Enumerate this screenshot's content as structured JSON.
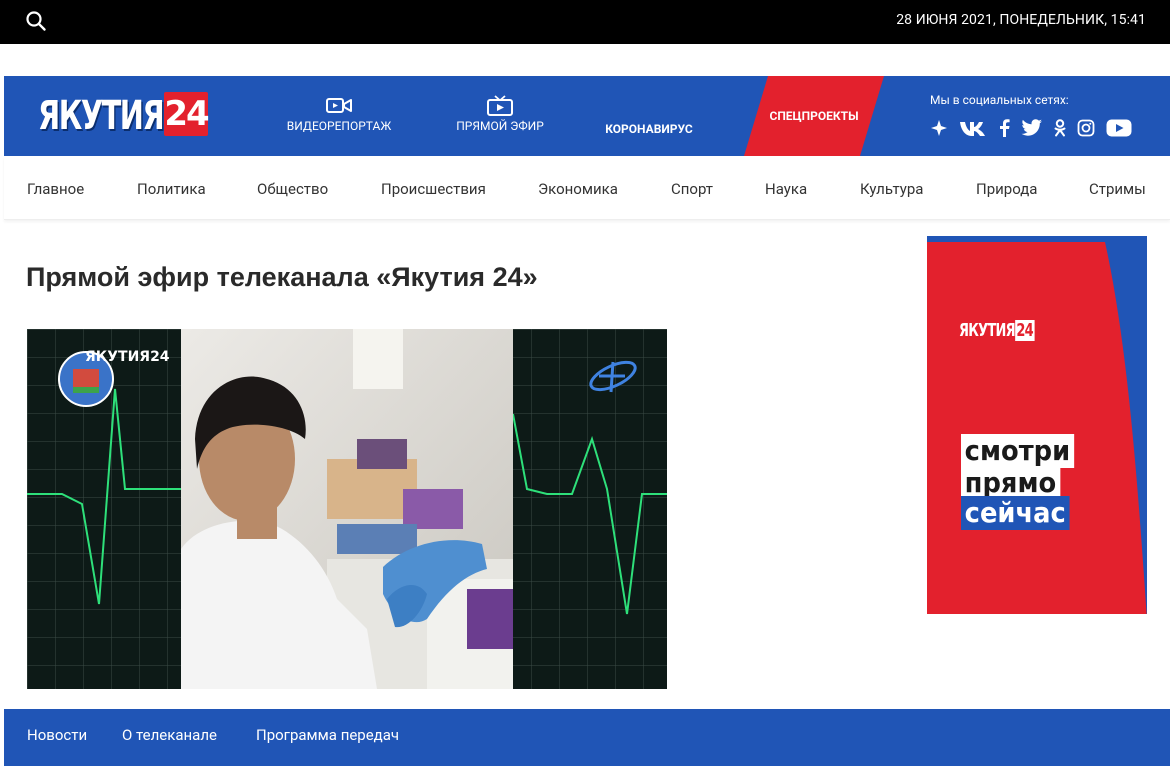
{
  "topbar": {
    "search_icon": "search-icon",
    "datetime": "28 ИЮНЯ 2021, ПОНЕДЕЛЬНИК, 15:41"
  },
  "header": {
    "logo_text": "ЯКУТИЯ",
    "logo_number": "24",
    "nav": [
      {
        "label": "ВИДЕОРЕПОРТАЖ",
        "icon": "video-camera-icon"
      },
      {
        "label": "ПРЯМОЙ ЭФИР",
        "icon": "tv-play-icon"
      },
      {
        "label": "КОРОНАВИРУС"
      }
    ],
    "special_label": "СПЕЦПРОЕКТЫ",
    "social_title": "Мы в социальных сетях:",
    "social_icons": [
      "yandex-zen-icon",
      "vk-icon",
      "facebook-icon",
      "twitter-icon",
      "odnoklassniki-icon",
      "instagram-icon",
      "youtube-icon"
    ],
    "colors": {
      "blue": "#2055b6",
      "red": "#e3212d"
    }
  },
  "categories": [
    "Главное",
    "Политика",
    "Общество",
    "Происшествия",
    "Экономика",
    "Спорт",
    "Наука",
    "Культура",
    "Природа",
    "Стримы"
  ],
  "main": {
    "title": "Прямой эфир телеканала «Якутия 24»",
    "video_logo": "ЯКУТИЯ24"
  },
  "banner": {
    "logo_text": "ЯКУТИЯ",
    "logo_number": "24",
    "line1": "смотри",
    "line2": "прямо",
    "line3": "сейчас"
  },
  "footer": {
    "links": [
      "Новости",
      "О телеканале",
      "Программа передач"
    ]
  }
}
